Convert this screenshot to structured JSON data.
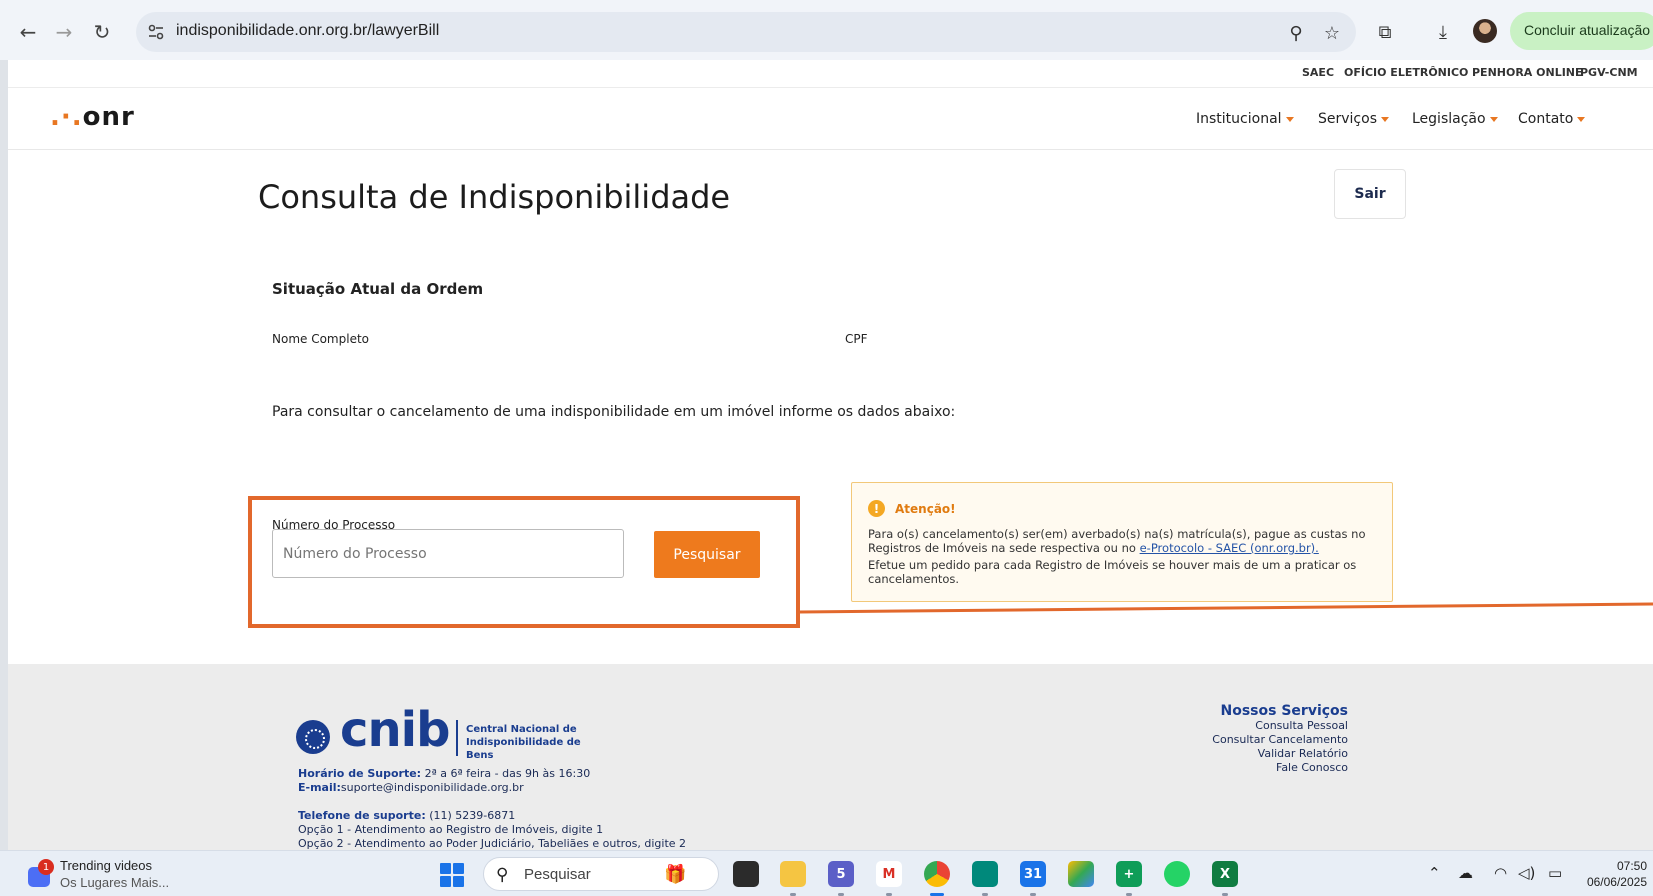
{
  "browser": {
    "url": "indisponibilidade.onr.org.br/lawyerBill",
    "update_button": "Concluir atualização"
  },
  "topbar": {
    "links": [
      "SAEC",
      "OFÍCIO ELETRÔNICO",
      "PENHORA ONLINE",
      "PGV-CNM"
    ]
  },
  "nav": {
    "logo": ".·.onr",
    "menu": [
      "Institucional",
      "Serviços",
      "Legislação",
      "Contato"
    ]
  },
  "main": {
    "title": "Consulta de Indisponibilidade",
    "logout_button": "Sair",
    "order_section_title": "Situação Atual da Ordem",
    "full_name_label": "Nome Completo",
    "cpf_label": "CPF",
    "instruction": "Para consultar o cancelamento de uma indisponibilidade em um imóvel informe os dados abaixo:",
    "process_label": "Número do Processo",
    "process_placeholder": "Número do Processo",
    "search_button": "Pesquisar"
  },
  "alert": {
    "title": "Atenção!",
    "line1_before": "Para o(s) cancelamento(s) ser(em) averbado(s) na(s) matrícula(s), pague as custas no Registros de Imóveis na sede respectiva ou no ",
    "line1_link": "e-Protocolo - SAEC (onr.org.br).",
    "line2": "Efetue um pedido para cada Registro de Imóveis se houver mais de um a praticar os cancelamentos."
  },
  "footer": {
    "cnib_wordmark": "cnib",
    "cnib_name": "Central Nacional de Indisponibilidade de Bens",
    "support_hours_label": "Horário de Suporte:",
    "support_hours": " 2ª a 6ª feira - das 9h às 16:30",
    "email_label": "E-mail:",
    "email": "suporte@indisponibilidade.org.br",
    "phone_label": "Telefone de suporte:",
    "phone": " (11) 5239-6871",
    "option1": "Opção 1 - Atendimento ao Registro de Imóveis, digite 1",
    "option2": "Opção 2 - Atendimento ao Poder Judiciário, Tabeliães e outros, digite 2",
    "services_title": "Nossos Serviços",
    "services": [
      "Consulta Pessoal",
      "Consultar Cancelamento",
      "Validar Relatório",
      "Fale Conosco"
    ]
  },
  "taskbar": {
    "widget_badge": "1",
    "widget_title": "Trending videos",
    "widget_subtitle": "Os Lugares Mais...",
    "search_placeholder": "Pesquisar",
    "teams_badge": "5",
    "time": "07:50",
    "date": "06/06/2025"
  }
}
